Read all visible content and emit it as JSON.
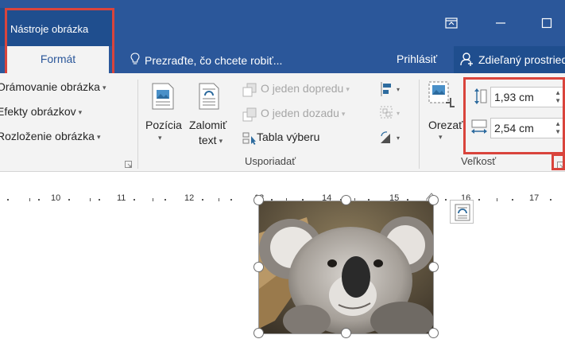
{
  "titlebar": {
    "context_title": "Nástroje obrázka",
    "restore_icon": "ribbon-display-options-icon",
    "minimize_icon": "minimize-icon",
    "maximize_icon": "maximize-icon"
  },
  "tabs": {
    "format_label": "Formát",
    "tell_me": "Prezraďte, čo chcete robiť...",
    "signin": "Prihlásiť",
    "share": "Zdieľaný prostriedok"
  },
  "picture_styles": {
    "border": "Orámovanie obrázka",
    "effects": "Efekty obrázkov",
    "layout": "Rozloženie obrázka"
  },
  "arrange": {
    "position": "Pozícia",
    "wrap_line1": "Zalomiť",
    "wrap_line2": "text",
    "bring_forward": "O jeden dopredu",
    "send_backward": "O jeden dozadu",
    "selection_pane": "Tabla výberu",
    "label": "Usporiadať"
  },
  "size": {
    "crop": "Orezať",
    "height": "1,93 cm",
    "width": "2,54 cm",
    "label": "Veľkosť"
  },
  "ruler": {
    "numbers": [
      "10",
      "11",
      "12",
      "13",
      "14",
      "15",
      "16",
      "17"
    ]
  },
  "colors": {
    "brand": "#2b579a",
    "highlight": "#d9443c"
  }
}
